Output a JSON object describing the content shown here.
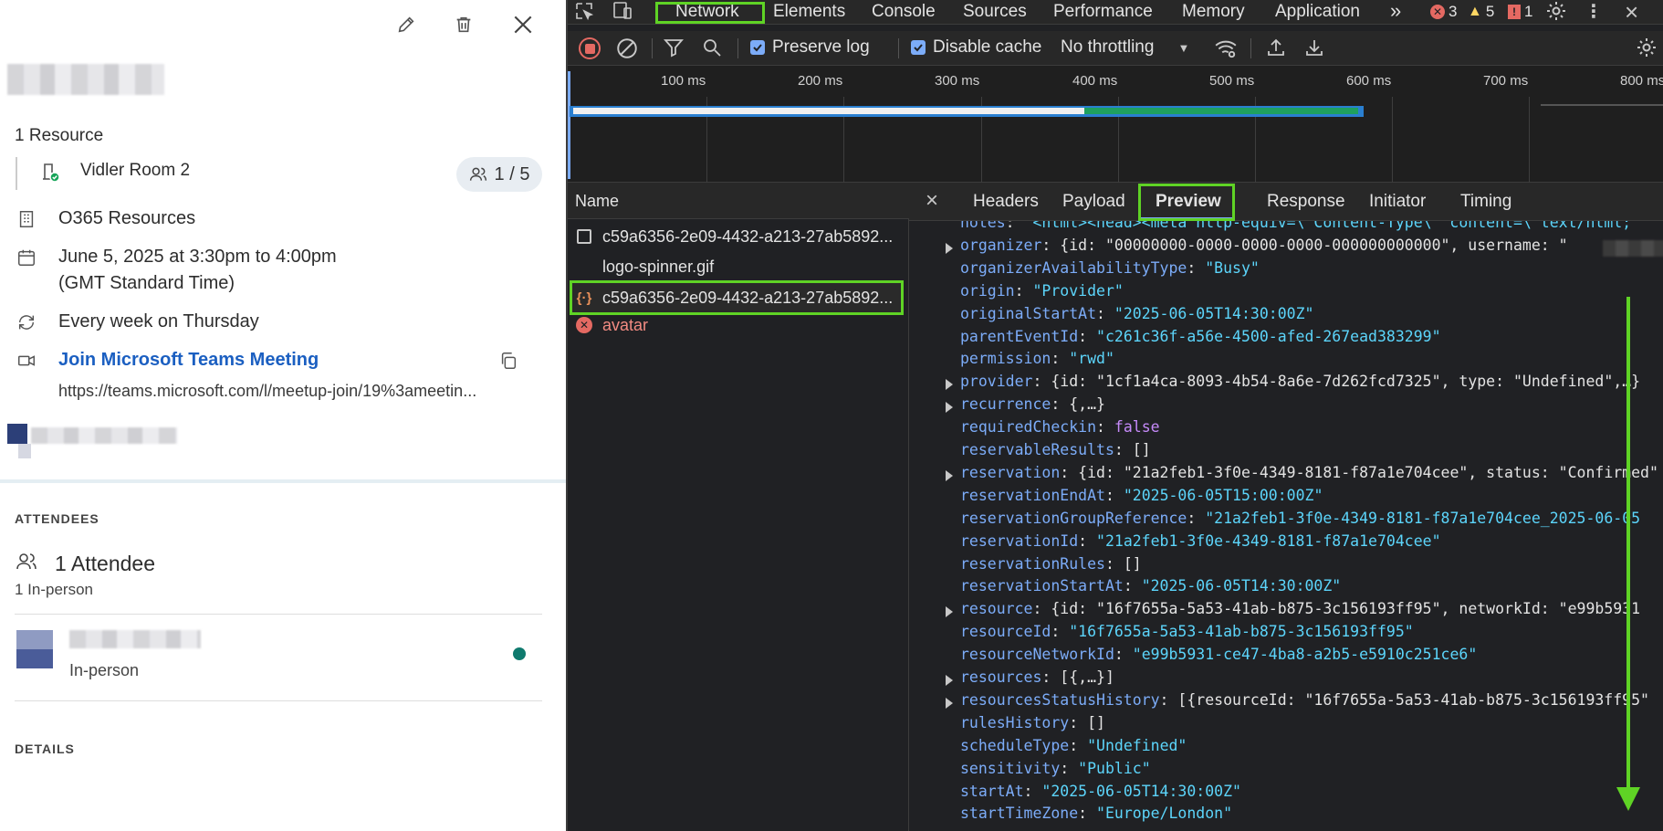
{
  "left_panel": {
    "resources_heading": "1 Resource",
    "room_name": "Vidler Room 2",
    "capacity": "1 / 5",
    "calendar": "O365 Resources",
    "date_line1": "June 5, 2025 at 3:30pm to 4:00pm",
    "date_line2": "(GMT Standard Time)",
    "recurrence": "Every week on Thursday",
    "meeting_link": "Join Microsoft Teams Meeting",
    "meeting_url": "https://teams.microsoft.com/l/meetup-join/19%3ameetin...",
    "attendees_label": "ATTENDEES",
    "attendee_count": "1 Attendee",
    "attendee_inperson": "1 In-person",
    "attendee_status": "In-person",
    "details_label": "DETAILS",
    "presence_color": "#0f7a6e"
  },
  "devtools": {
    "tabs": [
      "Network",
      "Elements",
      "Console",
      "Sources",
      "Performance",
      "Memory",
      "Application"
    ],
    "more_tabs": "»",
    "errors": "3",
    "warnings": "5",
    "issues": "1",
    "toolbar": {
      "preserve_log": "Preserve log",
      "disable_cache": "Disable cache",
      "throttling": "No throttling"
    },
    "timeline_ticks": [
      "100 ms",
      "200 ms",
      "300 ms",
      "400 ms",
      "500 ms",
      "600 ms",
      "700 ms",
      "800 ms"
    ],
    "name_header": "Name",
    "requests": [
      {
        "name": "c59a6356-2e09-4432-a213-27ab5892...",
        "icon": "document-icon"
      },
      {
        "name": "logo-spinner.gif",
        "icon": "none"
      },
      {
        "name": "c59a6356-2e09-4432-a213-27ab5892...",
        "icon": "json-icon"
      },
      {
        "name": "avatar",
        "icon": "error-icon"
      }
    ],
    "detail_tabs": [
      "Headers",
      "Payload",
      "Preview",
      "Response",
      "Initiator",
      "Timing"
    ],
    "active_detail_tab": "Preview",
    "json_lines": [
      {
        "key": "notes",
        "val": "\"<html><head><meta http-equiv=\\\"Content-Type\\\" content=\\\"text/html;",
        "type": "s",
        "exp": false
      },
      {
        "key": "organizer",
        "val": "{id: \"00000000-0000-0000-0000-000000000000\", username: \"",
        "type": "v",
        "exp": true
      },
      {
        "key": "organizerAvailabilityType",
        "val": "\"Busy\"",
        "type": "s",
        "exp": false
      },
      {
        "key": "origin",
        "val": "\"Provider\"",
        "type": "s",
        "exp": false
      },
      {
        "key": "originalStartAt",
        "val": "\"2025-06-05T14:30:00Z\"",
        "type": "s",
        "exp": false
      },
      {
        "key": "parentEventId",
        "val": "\"c261c36f-a56e-4500-afed-267ead383299\"",
        "type": "s",
        "exp": false
      },
      {
        "key": "permission",
        "val": "\"rwd\"",
        "type": "s",
        "exp": false
      },
      {
        "key": "provider",
        "val": "{id: \"1cf1a4ca-8093-4b54-8a6e-7d262fcd7325\", type: \"Undefined\",…}",
        "type": "v",
        "exp": true
      },
      {
        "key": "recurrence",
        "val": "{,…}",
        "type": "v",
        "exp": true
      },
      {
        "key": "requiredCheckin",
        "val": "false",
        "type": "b",
        "exp": false
      },
      {
        "key": "reservableResults",
        "val": "[]",
        "type": "v",
        "exp": false
      },
      {
        "key": "reservation",
        "val": "{id: \"21a2feb1-3f0e-4349-8181-f87a1e704cee\", status: \"Confirmed\"",
        "type": "v",
        "exp": true
      },
      {
        "key": "reservationEndAt",
        "val": "\"2025-06-05T15:00:00Z\"",
        "type": "s",
        "exp": false
      },
      {
        "key": "reservationGroupReference",
        "val": "\"21a2feb1-3f0e-4349-8181-f87a1e704cee_2025-06-05",
        "type": "s",
        "exp": false
      },
      {
        "key": "reservationId",
        "val": "\"21a2feb1-3f0e-4349-8181-f87a1e704cee\"",
        "type": "s",
        "exp": false
      },
      {
        "key": "reservationRules",
        "val": "[]",
        "type": "v",
        "exp": false
      },
      {
        "key": "reservationStartAt",
        "val": "\"2025-06-05T14:30:00Z\"",
        "type": "s",
        "exp": false
      },
      {
        "key": "resource",
        "val": "{id: \"16f7655a-5a53-41ab-b875-3c156193ff95\", networkId: \"e99b5931",
        "type": "v",
        "exp": true
      },
      {
        "key": "resourceId",
        "val": "\"16f7655a-5a53-41ab-b875-3c156193ff95\"",
        "type": "s",
        "exp": false
      },
      {
        "key": "resourceNetworkId",
        "val": "\"e99b5931-ce47-4ba8-a2b5-e5910c251ce6\"",
        "type": "s",
        "exp": false
      },
      {
        "key": "resources",
        "val": "[{,…}]",
        "type": "v",
        "exp": true
      },
      {
        "key": "resourcesStatusHistory",
        "val": "[{resourceId: \"16f7655a-5a53-41ab-b875-3c156193ff95\"",
        "type": "v",
        "exp": true
      },
      {
        "key": "rulesHistory",
        "val": "[]",
        "type": "v",
        "exp": false
      },
      {
        "key": "scheduleType",
        "val": "\"Undefined\"",
        "type": "s",
        "exp": false
      },
      {
        "key": "sensitivity",
        "val": "\"Public\"",
        "type": "s",
        "exp": false
      },
      {
        "key": "startAt",
        "val": "\"2025-06-05T14:30:00Z\"",
        "type": "s",
        "exp": false
      },
      {
        "key": "startTimeZone",
        "val": "\"Europe/London\"",
        "type": "s",
        "exp": false
      }
    ],
    "highlight_color": "#5fd325"
  }
}
